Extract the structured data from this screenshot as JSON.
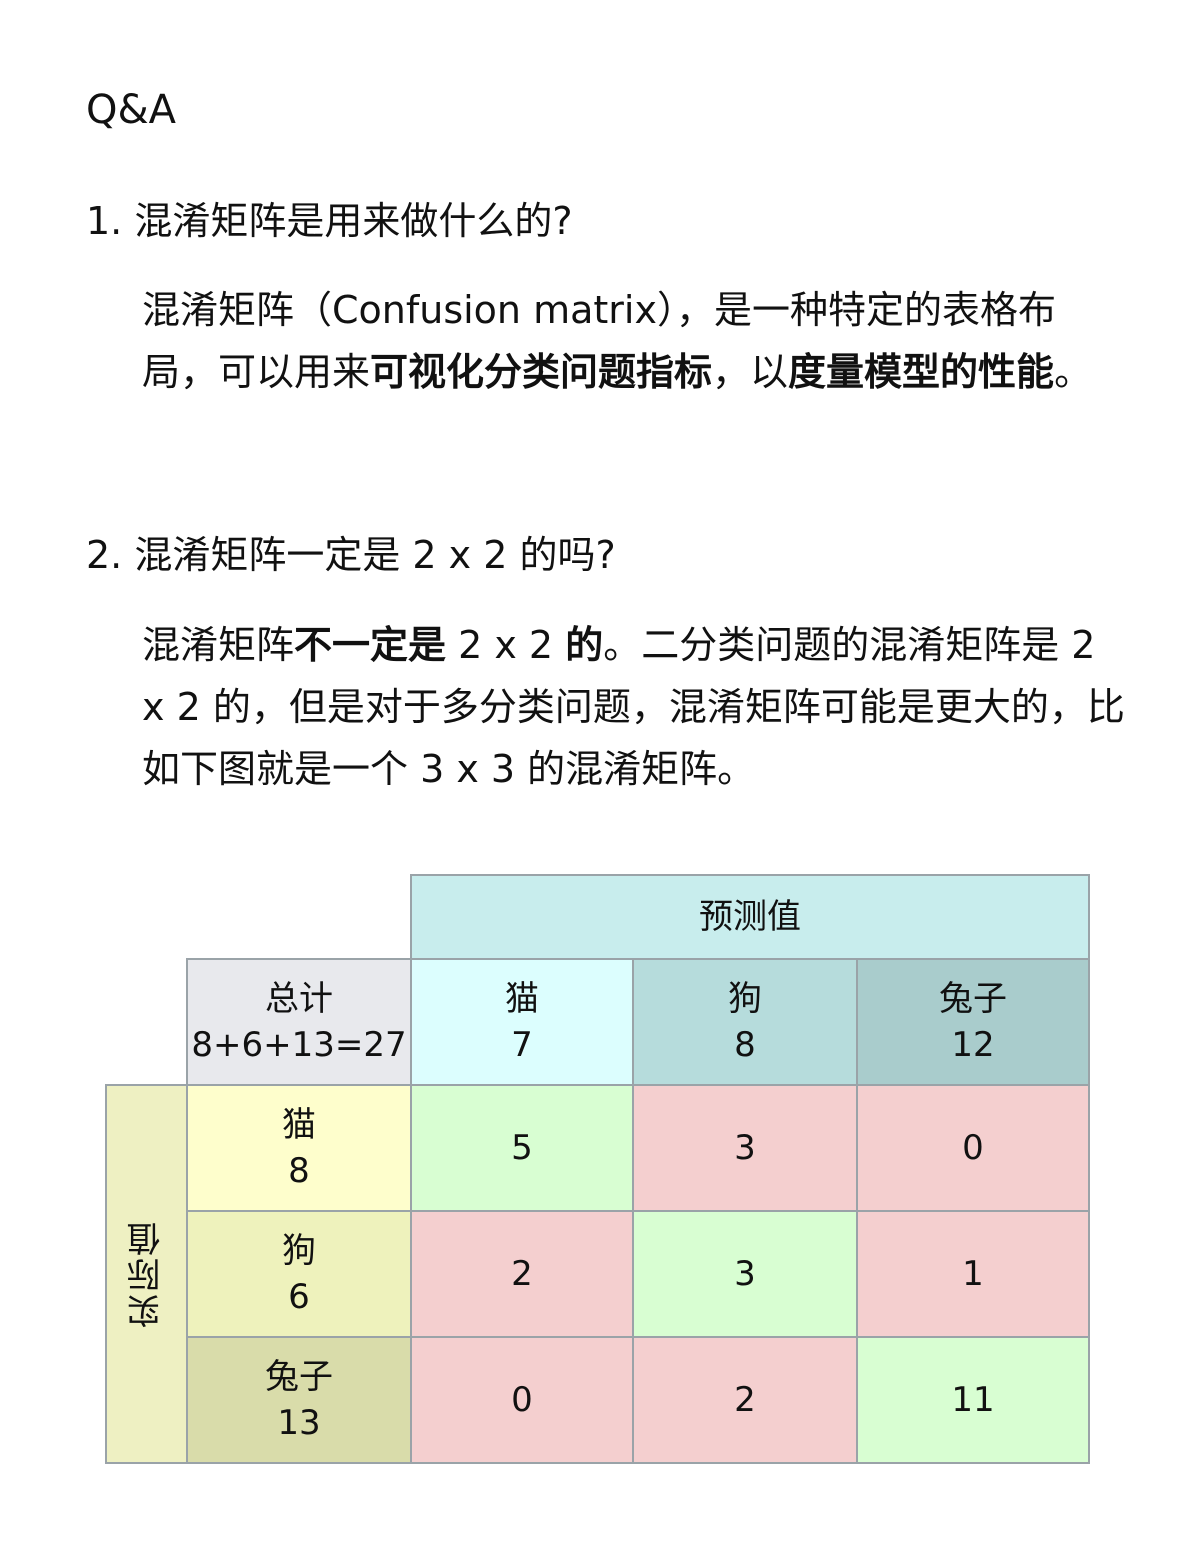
{
  "heading": "Q&A",
  "q1": {
    "question": "1. 混淆矩阵是用来做什么的?",
    "answer_parts": [
      {
        "text": "混淆矩阵（Confusion matrix），是一种特定的表格布局，可以用来",
        "bold": false
      },
      {
        "text": "可视化分类问题指标",
        "bold": true
      },
      {
        "text": "，以",
        "bold": false
      },
      {
        "text": "度量模型的性能",
        "bold": true
      },
      {
        "text": "。",
        "bold": false
      }
    ]
  },
  "q2": {
    "question": "2. 混淆矩阵一定是 2 x 2 的吗?",
    "answer_parts": [
      {
        "text": "混淆矩阵",
        "bold": false
      },
      {
        "text": "不一定是",
        "bold": true
      },
      {
        "text": " 2 x 2 ",
        "bold": false
      },
      {
        "text": "的",
        "bold": true
      },
      {
        "text": "。二分类问题的混淆矩阵是 2 x 2 的，但是对于多分类问题，混淆矩阵可能是更大的，比如下图就是一个 3 x 3 的混淆矩阵。",
        "bold": false
      }
    ]
  },
  "matrix": {
    "predicted_label": "预测值",
    "actual_label": "实际值",
    "total_label": "总计",
    "total_value": "8+6+13=27",
    "columns": [
      {
        "label": "猫",
        "count": "7",
        "color": "#dcfefe"
      },
      {
        "label": "狗",
        "count": "8",
        "color": "#b6dcdc"
      },
      {
        "label": "兔子",
        "count": "12",
        "color": "#a9cccc"
      }
    ],
    "rows": [
      {
        "label": "猫",
        "count": "8",
        "color": "#fefecc"
      },
      {
        "label": "狗",
        "count": "6",
        "color": "#eef2bc"
      },
      {
        "label": "兔子",
        "count": "13",
        "color": "#d9dcaa"
      }
    ],
    "values": [
      [
        "5",
        "3",
        "0"
      ],
      [
        "2",
        "3",
        "1"
      ],
      [
        "0",
        "2",
        "11"
      ]
    ],
    "colors": {
      "correct": "#d8fed2",
      "wrong": "#f4cfcf",
      "predicted_header": "#c8eded",
      "actual_header": "#eef0c2",
      "total": "#e8e9ed"
    }
  }
}
